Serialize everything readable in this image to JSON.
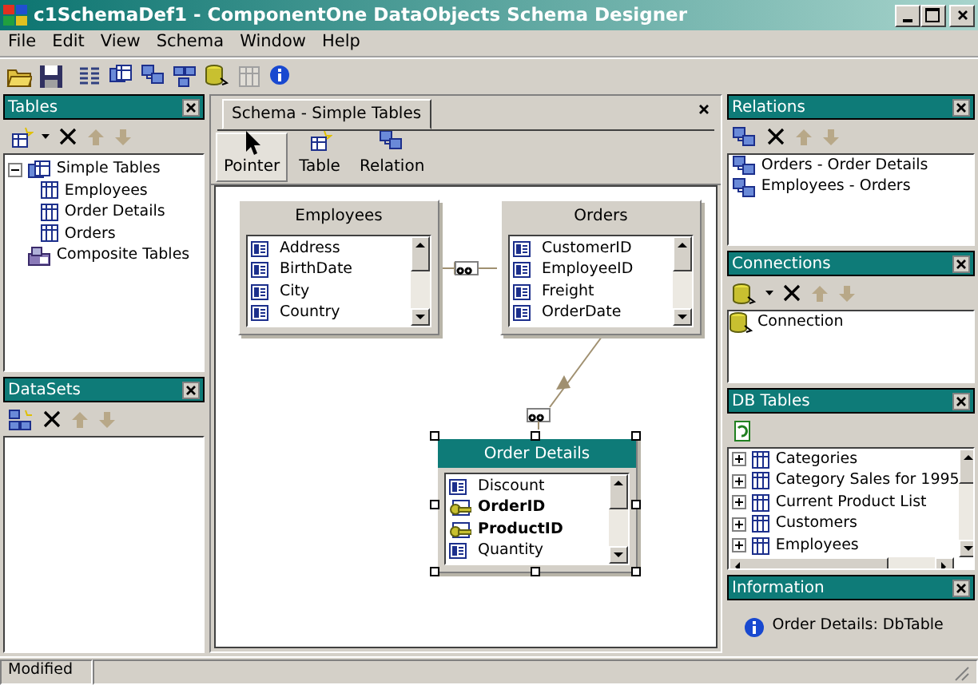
{
  "window": {
    "title": "c1SchemaDef1 - ComponentOne DataObjects Schema Designer"
  },
  "menu": [
    "File",
    "Edit",
    "View",
    "Schema",
    "Window",
    "Help"
  ],
  "tables_panel": {
    "title": "Tables",
    "tree": [
      {
        "label": "Simple Tables",
        "kind": "group",
        "expanded": true,
        "children": [
          {
            "label": "Employees",
            "kind": "table"
          },
          {
            "label": "Order Details",
            "kind": "table"
          },
          {
            "label": "Orders",
            "kind": "table"
          }
        ]
      },
      {
        "label": "Composite Tables",
        "kind": "composite"
      }
    ]
  },
  "datasets_panel": {
    "title": "DataSets"
  },
  "schema_tab": {
    "title": "Schema - Simple Tables"
  },
  "tools": [
    {
      "label": "Pointer",
      "kind": "pointer",
      "selected": true
    },
    {
      "label": "Table",
      "kind": "table",
      "selected": false
    },
    {
      "label": "Relation",
      "kind": "relation",
      "selected": false
    }
  ],
  "entities": [
    {
      "name": "Employees",
      "selected": false,
      "fields": [
        {
          "name": "Address",
          "key": false
        },
        {
          "name": "BirthDate",
          "key": false
        },
        {
          "name": "City",
          "key": false
        },
        {
          "name": "Country",
          "key": false
        }
      ]
    },
    {
      "name": "Orders",
      "selected": false,
      "fields": [
        {
          "name": "CustomerID",
          "key": false
        },
        {
          "name": "EmployeeID",
          "key": false
        },
        {
          "name": "Freight",
          "key": false
        },
        {
          "name": "OrderDate",
          "key": false
        }
      ]
    },
    {
      "name": "Order Details",
      "selected": true,
      "fields": [
        {
          "name": "Discount",
          "key": false
        },
        {
          "name": "OrderID",
          "key": true
        },
        {
          "name": "ProductID",
          "key": true
        },
        {
          "name": "Quantity",
          "key": false
        }
      ]
    }
  ],
  "relations_panel": {
    "title": "Relations",
    "items": [
      "Orders - Order Details",
      "Employees - Orders"
    ]
  },
  "connections_panel": {
    "title": "Connections",
    "items": [
      "Connection"
    ]
  },
  "db_tables_panel": {
    "title": "DB Tables",
    "items": [
      {
        "label": "Categories",
        "expanded": false
      },
      {
        "label": "Category Sales for 1995",
        "expanded": false
      },
      {
        "label": "Current Product List",
        "expanded": false
      },
      {
        "label": "Customers",
        "expanded": false
      },
      {
        "label": "Employees",
        "expanded": false
      }
    ]
  },
  "information_panel": {
    "title": "Information",
    "text": "Order Details: DbTable"
  },
  "status_bar": {
    "text": "Modified"
  }
}
